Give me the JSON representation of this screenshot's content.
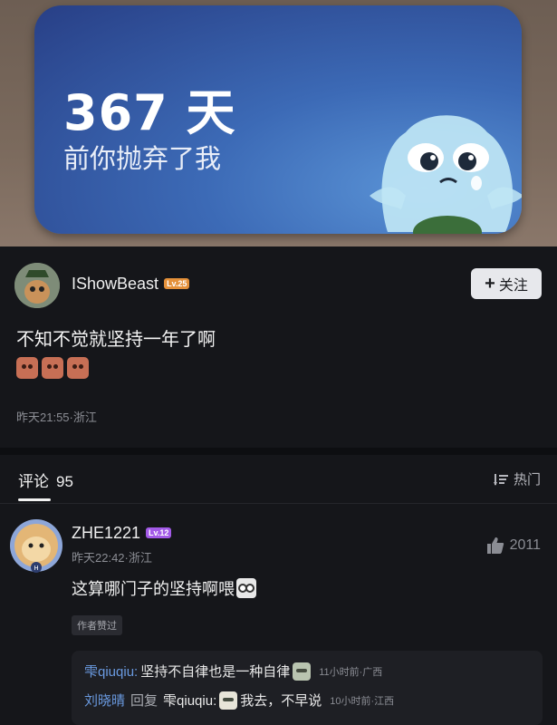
{
  "hero": {
    "days": "367 天",
    "subtitle": "前你抛弃了我"
  },
  "post": {
    "username": "IShowBeast",
    "level": "Lv.25",
    "follow_label": "关注",
    "title": "不知不觉就坚持一年了啊",
    "timestamp": "昨天21:55·浙江"
  },
  "comments_bar": {
    "tab_label": "评论",
    "count": "95",
    "sort_label": "热门"
  },
  "comment": {
    "username": "ZHE1221",
    "level": "Lv.12",
    "timestamp": "昨天22:42·浙江",
    "likes": "2011",
    "text": "这算哪门子的坚持啊喂",
    "author_liked": "作者赞过",
    "replies": [
      {
        "user": "雫qiuqiu:",
        "text": "坚持不自律也是一种自律",
        "time": "11小时前·广西"
      },
      {
        "user": "刘晓晴",
        "verb": "回复",
        "target": "雫qiuqiu:",
        "text": "我去，不早说",
        "time": "10小时前·江西"
      }
    ]
  },
  "colors": {
    "background": "#15161a",
    "accent_link": "#6a9ae0",
    "level_orange": "#e5913a",
    "level_purple": "#a35ae8"
  }
}
